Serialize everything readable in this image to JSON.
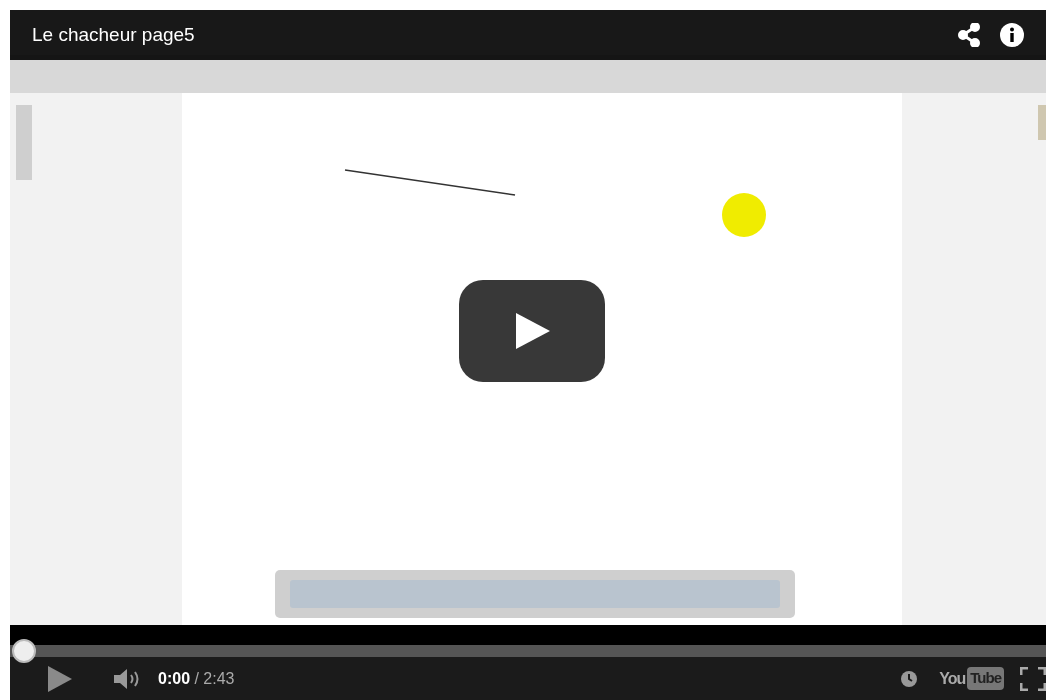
{
  "video": {
    "title": "Le chacheur page5"
  },
  "progress": {
    "level": 0
  },
  "controls": {
    "current_time": "0:00",
    "separator": " / ",
    "duration": "2:43",
    "muted": false
  },
  "logo": {
    "you": "You",
    "tube": "Tube"
  }
}
